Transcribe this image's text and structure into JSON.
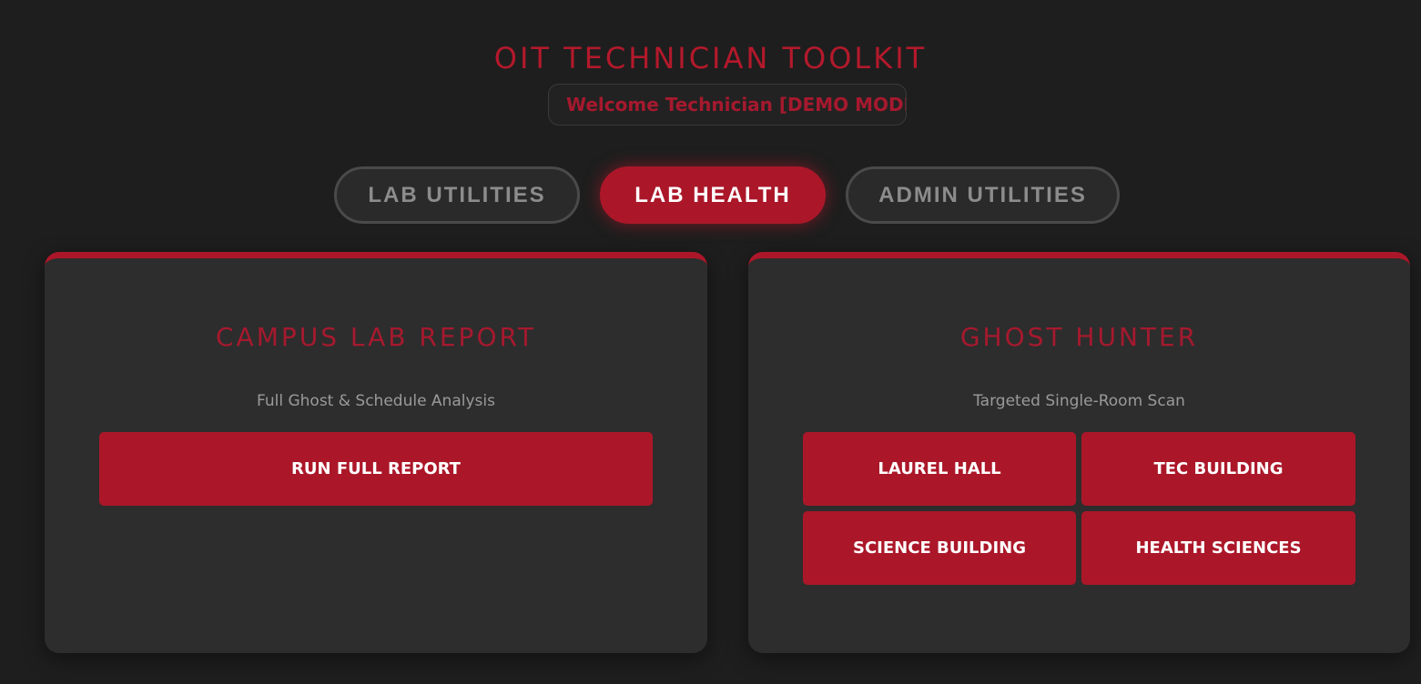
{
  "header": {
    "title": "OIT TECHNICIAN TOOLKIT",
    "welcome": "Welcome Technician [DEMO MODE"
  },
  "tabs": [
    {
      "label": "LAB UTILITIES",
      "active": false
    },
    {
      "label": "LAB HEALTH",
      "active": true
    },
    {
      "label": "ADMIN UTILITIES",
      "active": false
    }
  ],
  "cards": {
    "campus_report": {
      "title": "CAMPUS LAB REPORT",
      "subtitle": "Full Ghost & Schedule Analysis",
      "button": "RUN FULL REPORT"
    },
    "ghost_hunter": {
      "title": "GHOST HUNTER",
      "subtitle": "Targeted Single-Room Scan",
      "buttons": [
        "LAUREL HALL",
        "TEC BUILDING",
        "SCIENCE BUILDING",
        "HEALTH SCIENCES"
      ]
    }
  },
  "colors": {
    "background": "#1e1e1e",
    "card": "#2d2d2d",
    "accent": "#ab1729",
    "text_muted": "#9a9a9a"
  }
}
